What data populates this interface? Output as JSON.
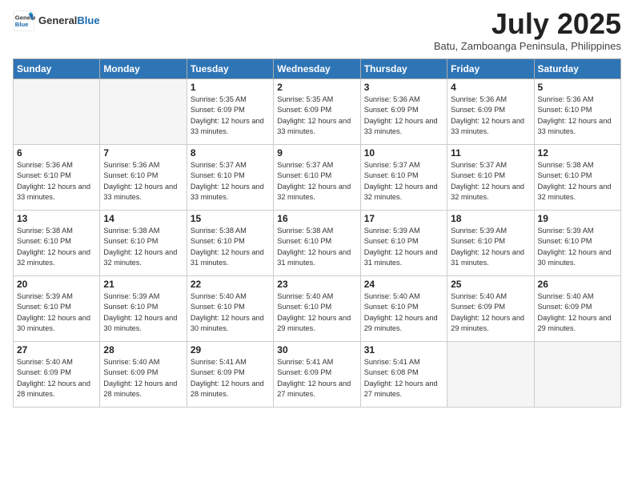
{
  "header": {
    "logo_general": "General",
    "logo_blue": "Blue",
    "month": "July 2025",
    "location": "Batu, Zamboanga Peninsula, Philippines"
  },
  "weekdays": [
    "Sunday",
    "Monday",
    "Tuesday",
    "Wednesday",
    "Thursday",
    "Friday",
    "Saturday"
  ],
  "weeks": [
    [
      {
        "day": "",
        "empty": true
      },
      {
        "day": "",
        "empty": true
      },
      {
        "day": "1",
        "sunrise": "5:35 AM",
        "sunset": "6:09 PM",
        "daylight": "12 hours and 33 minutes."
      },
      {
        "day": "2",
        "sunrise": "5:35 AM",
        "sunset": "6:09 PM",
        "daylight": "12 hours and 33 minutes."
      },
      {
        "day": "3",
        "sunrise": "5:36 AM",
        "sunset": "6:09 PM",
        "daylight": "12 hours and 33 minutes."
      },
      {
        "day": "4",
        "sunrise": "5:36 AM",
        "sunset": "6:09 PM",
        "daylight": "12 hours and 33 minutes."
      },
      {
        "day": "5",
        "sunrise": "5:36 AM",
        "sunset": "6:10 PM",
        "daylight": "12 hours and 33 minutes."
      }
    ],
    [
      {
        "day": "6",
        "sunrise": "5:36 AM",
        "sunset": "6:10 PM",
        "daylight": "12 hours and 33 minutes."
      },
      {
        "day": "7",
        "sunrise": "5:36 AM",
        "sunset": "6:10 PM",
        "daylight": "12 hours and 33 minutes."
      },
      {
        "day": "8",
        "sunrise": "5:37 AM",
        "sunset": "6:10 PM",
        "daylight": "12 hours and 33 minutes."
      },
      {
        "day": "9",
        "sunrise": "5:37 AM",
        "sunset": "6:10 PM",
        "daylight": "12 hours and 32 minutes."
      },
      {
        "day": "10",
        "sunrise": "5:37 AM",
        "sunset": "6:10 PM",
        "daylight": "12 hours and 32 minutes."
      },
      {
        "day": "11",
        "sunrise": "5:37 AM",
        "sunset": "6:10 PM",
        "daylight": "12 hours and 32 minutes."
      },
      {
        "day": "12",
        "sunrise": "5:38 AM",
        "sunset": "6:10 PM",
        "daylight": "12 hours and 32 minutes."
      }
    ],
    [
      {
        "day": "13",
        "sunrise": "5:38 AM",
        "sunset": "6:10 PM",
        "daylight": "12 hours and 32 minutes."
      },
      {
        "day": "14",
        "sunrise": "5:38 AM",
        "sunset": "6:10 PM",
        "daylight": "12 hours and 32 minutes."
      },
      {
        "day": "15",
        "sunrise": "5:38 AM",
        "sunset": "6:10 PM",
        "daylight": "12 hours and 31 minutes."
      },
      {
        "day": "16",
        "sunrise": "5:38 AM",
        "sunset": "6:10 PM",
        "daylight": "12 hours and 31 minutes."
      },
      {
        "day": "17",
        "sunrise": "5:39 AM",
        "sunset": "6:10 PM",
        "daylight": "12 hours and 31 minutes."
      },
      {
        "day": "18",
        "sunrise": "5:39 AM",
        "sunset": "6:10 PM",
        "daylight": "12 hours and 31 minutes."
      },
      {
        "day": "19",
        "sunrise": "5:39 AM",
        "sunset": "6:10 PM",
        "daylight": "12 hours and 30 minutes."
      }
    ],
    [
      {
        "day": "20",
        "sunrise": "5:39 AM",
        "sunset": "6:10 PM",
        "daylight": "12 hours and 30 minutes."
      },
      {
        "day": "21",
        "sunrise": "5:39 AM",
        "sunset": "6:10 PM",
        "daylight": "12 hours and 30 minutes."
      },
      {
        "day": "22",
        "sunrise": "5:40 AM",
        "sunset": "6:10 PM",
        "daylight": "12 hours and 30 minutes."
      },
      {
        "day": "23",
        "sunrise": "5:40 AM",
        "sunset": "6:10 PM",
        "daylight": "12 hours and 29 minutes."
      },
      {
        "day": "24",
        "sunrise": "5:40 AM",
        "sunset": "6:10 PM",
        "daylight": "12 hours and 29 minutes."
      },
      {
        "day": "25",
        "sunrise": "5:40 AM",
        "sunset": "6:09 PM",
        "daylight": "12 hours and 29 minutes."
      },
      {
        "day": "26",
        "sunrise": "5:40 AM",
        "sunset": "6:09 PM",
        "daylight": "12 hours and 29 minutes."
      }
    ],
    [
      {
        "day": "27",
        "sunrise": "5:40 AM",
        "sunset": "6:09 PM",
        "daylight": "12 hours and 28 minutes."
      },
      {
        "day": "28",
        "sunrise": "5:40 AM",
        "sunset": "6:09 PM",
        "daylight": "12 hours and 28 minutes."
      },
      {
        "day": "29",
        "sunrise": "5:41 AM",
        "sunset": "6:09 PM",
        "daylight": "12 hours and 28 minutes."
      },
      {
        "day": "30",
        "sunrise": "5:41 AM",
        "sunset": "6:09 PM",
        "daylight": "12 hours and 27 minutes."
      },
      {
        "day": "31",
        "sunrise": "5:41 AM",
        "sunset": "6:08 PM",
        "daylight": "12 hours and 27 minutes."
      },
      {
        "day": "",
        "empty": true
      },
      {
        "day": "",
        "empty": true
      }
    ]
  ]
}
